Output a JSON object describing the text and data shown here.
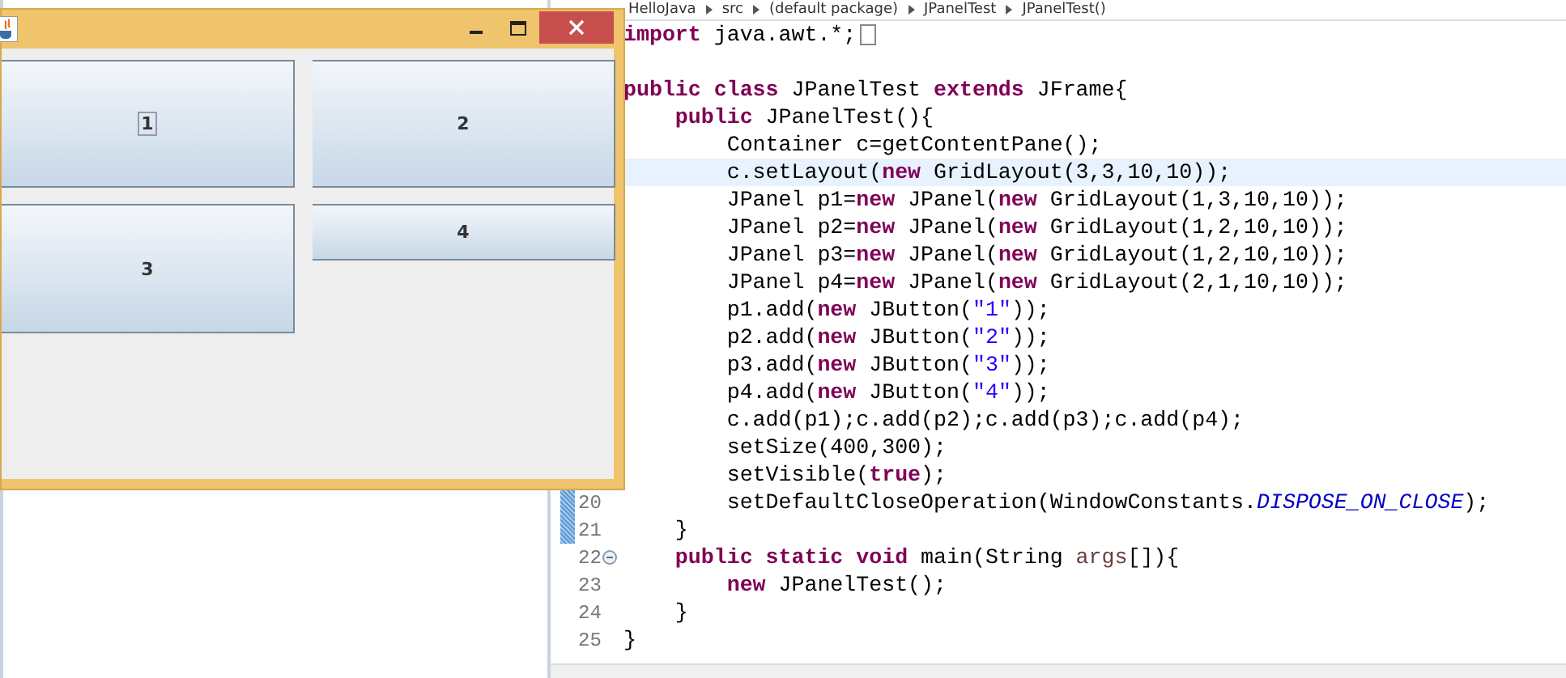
{
  "breadcrumb": [
    "HelloJava",
    "src",
    "(default package)",
    "JPanelTest",
    "JPanelTest()"
  ],
  "editor": {
    "lines": [
      {
        "tokens": [
          {
            "kind": "keyword",
            "text": "import"
          },
          {
            "kind": "plain",
            "text": " java.awt.*;"
          }
        ],
        "folded": true,
        "highlighted": false
      },
      {
        "highlighted": false
      },
      {
        "tokens": [
          {
            "kind": "keyword",
            "text": "public class"
          },
          {
            "kind": "plain",
            "text": " JPanelTest "
          },
          {
            "kind": "keyword",
            "text": "extends"
          },
          {
            "kind": "plain",
            "text": " JFrame{"
          }
        ],
        "highlighted": false
      },
      {
        "tokens": [
          {
            "kind": "keyword",
            "text": "    public"
          },
          {
            "kind": "plain",
            "text": " JPanelTest(){"
          }
        ],
        "highlighted": false
      },
      {
        "tokens": [
          {
            "kind": "plain",
            "text": "        Container c=getContentPane();"
          }
        ],
        "highlighted": false
      },
      {
        "tokens": [
          {
            "kind": "plain",
            "text": "        c.setLayout("
          },
          {
            "kind": "keyword",
            "text": "new"
          },
          {
            "kind": "plain",
            "text": " GridLayout(3,3,10,10));"
          }
        ],
        "highlighted": true
      },
      {
        "tokens": [
          {
            "kind": "plain",
            "text": "        JPanel p1="
          },
          {
            "kind": "keyword",
            "text": "new"
          },
          {
            "kind": "plain",
            "text": " JPanel("
          },
          {
            "kind": "keyword",
            "text": "new"
          },
          {
            "kind": "plain",
            "text": " GridLayout(1,3,10,10));"
          }
        ],
        "highlighted": false
      },
      {
        "tokens": [
          {
            "kind": "plain",
            "text": "        JPanel p2="
          },
          {
            "kind": "keyword",
            "text": "new"
          },
          {
            "kind": "plain",
            "text": " JPanel("
          },
          {
            "kind": "keyword",
            "text": "new"
          },
          {
            "kind": "plain",
            "text": " GridLayout(1,2,10,10));"
          }
        ],
        "highlighted": false
      },
      {
        "tokens": [
          {
            "kind": "plain",
            "text": "        JPanel p3="
          },
          {
            "kind": "keyword",
            "text": "new"
          },
          {
            "kind": "plain",
            "text": " JPanel("
          },
          {
            "kind": "keyword",
            "text": "new"
          },
          {
            "kind": "plain",
            "text": " GridLayout(1,2,10,10));"
          }
        ],
        "highlighted": false
      },
      {
        "tokens": [
          {
            "kind": "plain",
            "text": "        JPanel p4="
          },
          {
            "kind": "keyword",
            "text": "new"
          },
          {
            "kind": "plain",
            "text": " JPanel("
          },
          {
            "kind": "keyword",
            "text": "new"
          },
          {
            "kind": "plain",
            "text": " GridLayout(2,1,10,10));"
          }
        ],
        "highlighted": false
      },
      {
        "tokens": [
          {
            "kind": "plain",
            "text": "        p1.add("
          },
          {
            "kind": "keyword",
            "text": "new"
          },
          {
            "kind": "plain",
            "text": " JButton("
          },
          {
            "kind": "string",
            "text": "\"1\""
          },
          {
            "kind": "plain",
            "text": "));"
          }
        ],
        "highlighted": false
      },
      {
        "tokens": [
          {
            "kind": "plain",
            "text": "        p2.add("
          },
          {
            "kind": "keyword",
            "text": "new"
          },
          {
            "kind": "plain",
            "text": " JButton("
          },
          {
            "kind": "string",
            "text": "\"2\""
          },
          {
            "kind": "plain",
            "text": "));"
          }
        ],
        "highlighted": false
      },
      {
        "tokens": [
          {
            "kind": "plain",
            "text": "        p3.add("
          },
          {
            "kind": "keyword",
            "text": "new"
          },
          {
            "kind": "plain",
            "text": " JButton("
          },
          {
            "kind": "string",
            "text": "\"3\""
          },
          {
            "kind": "plain",
            "text": "));"
          }
        ],
        "highlighted": false
      },
      {
        "tokens": [
          {
            "kind": "plain",
            "text": "        p4.add("
          },
          {
            "kind": "keyword",
            "text": "new"
          },
          {
            "kind": "plain",
            "text": " JButton("
          },
          {
            "kind": "string",
            "text": "\"4\""
          },
          {
            "kind": "plain",
            "text": "));"
          }
        ],
        "highlighted": false
      },
      {
        "tokens": [
          {
            "kind": "plain",
            "text": "        c.add(p1);c.add(p2);c.add(p3);c.add(p4);"
          }
        ],
        "highlighted": false
      },
      {
        "tokens": [
          {
            "kind": "plain",
            "text": "        setSize(400,300);"
          }
        ],
        "highlighted": false
      },
      {
        "tokens": [
          {
            "kind": "plain",
            "text": "        setVisible("
          },
          {
            "kind": "keyword",
            "text": "true"
          },
          {
            "kind": "plain",
            "text": ");"
          }
        ],
        "highlighted": false
      },
      {
        "number": "20",
        "tokens": [
          {
            "kind": "plain",
            "text": "        setDefaultCloseOperation(WindowConstants."
          },
          {
            "kind": "constant",
            "text": "DISPOSE_ON_CLOSE"
          },
          {
            "kind": "plain",
            "text": ");"
          }
        ],
        "highlighted": false,
        "changed": true,
        "fold_toggle": false
      },
      {
        "number": "21",
        "tokens": [
          {
            "kind": "plain",
            "text": "    }"
          }
        ],
        "highlighted": false,
        "changed": true,
        "fold_toggle": false
      },
      {
        "number": "22",
        "tokens": [
          {
            "kind": "keyword",
            "text": "    public static void"
          },
          {
            "kind": "plain",
            "text": " main(String "
          },
          {
            "kind": "param",
            "text": "args"
          },
          {
            "kind": "plain",
            "text": "[]){"
          }
        ],
        "highlighted": false,
        "changed": false,
        "fold_toggle": true
      },
      {
        "number": "23",
        "tokens": [
          {
            "kind": "keyword",
            "text": "        new"
          },
          {
            "kind": "plain",
            "text": " JPanelTest();"
          }
        ],
        "highlighted": false,
        "changed": false,
        "fold_toggle": false
      },
      {
        "number": "24",
        "tokens": [
          {
            "kind": "plain",
            "text": "    }"
          }
        ],
        "highlighted": false,
        "changed": false,
        "fold_toggle": false
      },
      {
        "number": "25",
        "tokens": [
          {
            "kind": "plain",
            "text": "}"
          }
        ],
        "highlighted": false,
        "changed": false,
        "fold_toggle": false
      }
    ]
  },
  "swing_window": {
    "grid_rows": [
      {
        "panels": [
          {
            "kind": "full",
            "buttons": [
              {
                "label": "1",
                "focused": true
              }
            ]
          },
          {
            "kind": "full",
            "buttons": [
              {
                "label": "2",
                "focused": false
              }
            ]
          }
        ]
      },
      {
        "panels": [
          {
            "kind": "full",
            "buttons": [
              {
                "label": "3",
                "focused": false
              }
            ]
          },
          {
            "kind": "half",
            "buttons": [
              {
                "label": "4",
                "focused": false
              }
            ]
          }
        ]
      }
    ]
  }
}
